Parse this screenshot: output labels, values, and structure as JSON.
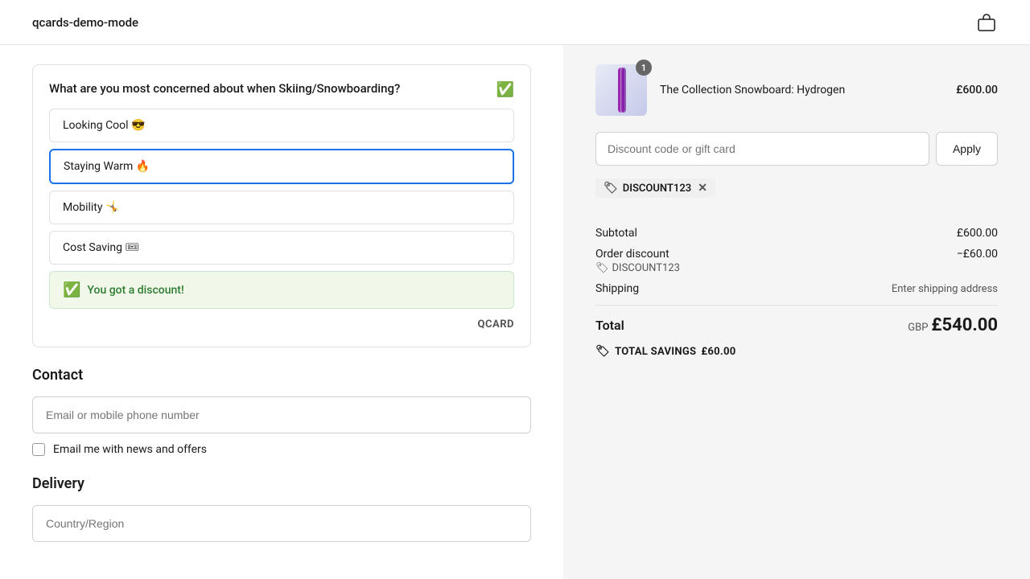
{
  "header": {
    "logo": "qcards-demo-mode",
    "cart_icon": "🛍"
  },
  "qcard": {
    "question": "What are you most concerned about when Skiing/Snowboarding?",
    "options": [
      {
        "id": "looking-cool",
        "label": "Looking Cool 😎",
        "selected": false
      },
      {
        "id": "staying-warm",
        "label": "Staying Warm 🔥",
        "selected": true
      },
      {
        "id": "mobility",
        "label": "Mobility 🤸",
        "selected": false
      },
      {
        "id": "cost-saving",
        "label": "Cost Saving 🎟",
        "selected": false
      }
    ],
    "success_message": "You got a discount!",
    "brand": "QCARD"
  },
  "contact": {
    "section_title": "Contact",
    "email_placeholder": "Email or mobile phone number",
    "checkbox_label": "Email me with news and offers"
  },
  "delivery": {
    "section_title": "Delivery",
    "country_placeholder": "Country/Region"
  },
  "order": {
    "product_name": "The Collection Snowboard: Hydrogen",
    "product_price": "£600.00",
    "product_badge": "1",
    "discount_placeholder": "Discount code or gift card",
    "apply_label": "Apply",
    "applied_code": "DISCOUNT123",
    "subtotal_label": "Subtotal",
    "subtotal_value": "£600.00",
    "order_discount_label": "Order discount",
    "discount_code_label": "DISCOUNT123",
    "discount_value": "−£60.00",
    "shipping_label": "Shipping",
    "shipping_value": "Enter shipping address",
    "total_label": "Total",
    "total_currency": "GBP",
    "total_value": "£540.00",
    "savings_label": "TOTAL SAVINGS",
    "savings_value": "£60.00"
  }
}
